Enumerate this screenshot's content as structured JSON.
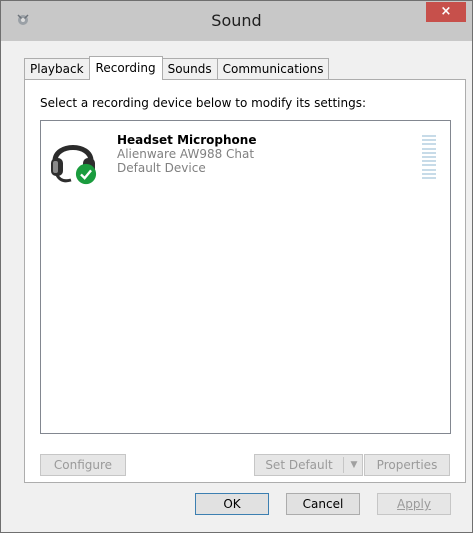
{
  "window": {
    "title": "Sound",
    "close_glyph": "×"
  },
  "tabs": [
    {
      "label": "Playback",
      "active": false
    },
    {
      "label": "Recording",
      "active": true
    },
    {
      "label": "Sounds",
      "active": false
    },
    {
      "label": "Communications",
      "active": false
    }
  ],
  "panel": {
    "instruction": "Select a recording device below to modify its settings:",
    "device": {
      "name": "Headset Microphone",
      "description": "Alienware AW988 Chat",
      "status": "Default Device",
      "icon": "headset-icon",
      "badge": "default-check-icon"
    },
    "buttons": {
      "configure": "Configure",
      "set_default": "Set Default",
      "properties": "Properties"
    }
  },
  "footer": {
    "ok": "OK",
    "cancel": "Cancel",
    "apply": "Apply"
  },
  "colors": {
    "close": "#c7504b",
    "check": "#1a9c3e",
    "meter": "#c7dbe8"
  }
}
